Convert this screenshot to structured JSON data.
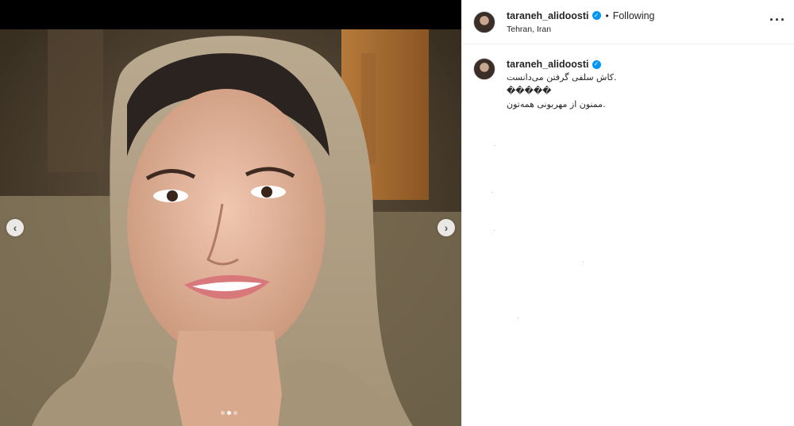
{
  "post": {
    "author": {
      "username": "taraneh_alidoosti",
      "verified": true,
      "follow_status": "Following",
      "location": "Tehran, Iran"
    },
    "caption_lines": [
      "کاش سلفی گرفتن می‌دانست.",
      "�����",
      "ممنون از مهربونی همه‌تون."
    ],
    "more_label": "···",
    "carousel": {
      "count": 3,
      "active_index": 1
    }
  },
  "icons": {
    "prev": "chevron-left-icon",
    "next": "chevron-right-icon",
    "verified": "verified-badge-icon",
    "more": "more-options-icon"
  },
  "colors": {
    "verified_blue": "#0095f6",
    "divider": "#efefef"
  }
}
